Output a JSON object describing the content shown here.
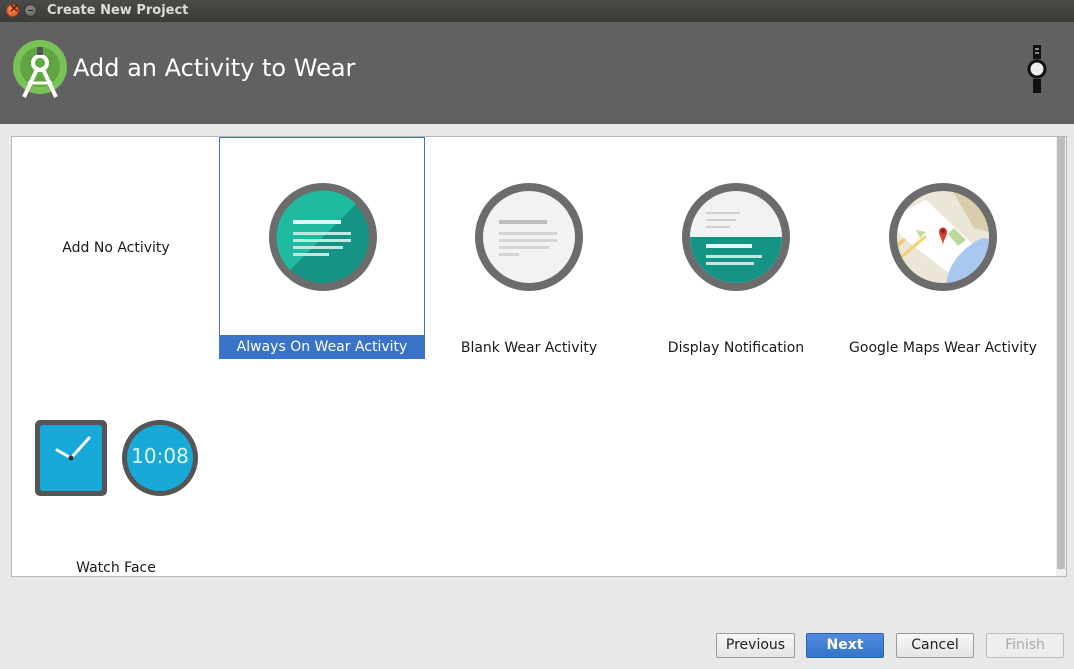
{
  "window": {
    "title": "Create New Project"
  },
  "header": {
    "title": "Add an Activity to Wear"
  },
  "gallery": {
    "tiles": [
      {
        "label": "Add No Activity"
      },
      {
        "label": "Always On Wear Activity",
        "selected": true
      },
      {
        "label": "Blank Wear Activity"
      },
      {
        "label": "Display Notification"
      },
      {
        "label": "Google Maps Wear Activity"
      },
      {
        "label": "Watch Face",
        "clock_text": "10:08"
      }
    ]
  },
  "buttons": {
    "previous": "Previous",
    "next": "Next",
    "cancel": "Cancel",
    "finish": "Finish"
  },
  "colors": {
    "selection": "#3b73c8",
    "wear_teal": "#1a9e8c",
    "watch_blue": "#17a9d8"
  }
}
